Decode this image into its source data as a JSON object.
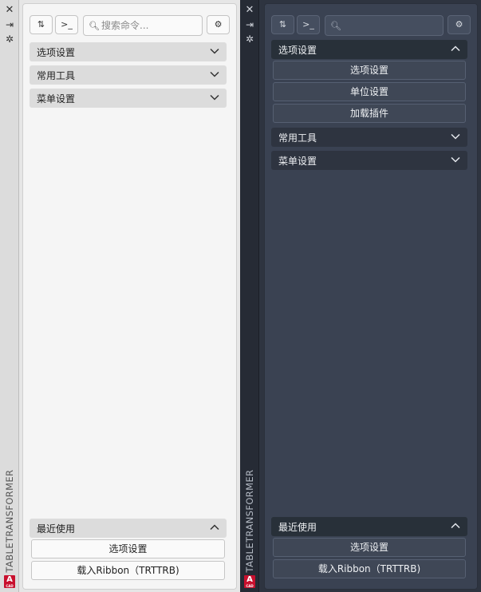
{
  "palette_title": "TABLETRANSFORMER",
  "search": {
    "placeholder": "搜索命令..."
  },
  "icons": {
    "close": "close-icon",
    "pin": "pin-icon",
    "settings": "settings-icon",
    "sort": "sort-icon",
    "prompt": "command-prompt-icon",
    "search": "search-icon",
    "chevron_down": "chevron-down-icon",
    "chevron_up": "chevron-up-icon",
    "logo": "autocad-logo"
  },
  "colors": {
    "light_bg": "#f5f5f5",
    "light_section": "#dcdcdc",
    "dark_bg": "#3a4252",
    "dark_section": "#2e3440",
    "logo_red": "#c8102e"
  },
  "light": {
    "sections": [
      {
        "label": "选项设置",
        "expanded": false
      },
      {
        "label": "常用工具",
        "expanded": false
      },
      {
        "label": "菜单设置",
        "expanded": false
      }
    ],
    "recent": {
      "label": "最近使用",
      "expanded": true,
      "items": [
        "选项设置",
        "载入Ribbon（TRTTRB)"
      ]
    }
  },
  "dark": {
    "sections": [
      {
        "label": "选项设置",
        "expanded": true,
        "items": [
          "选项设置",
          "单位设置",
          "加载插件"
        ]
      },
      {
        "label": "常用工具",
        "expanded": false
      },
      {
        "label": "菜单设置",
        "expanded": false
      }
    ],
    "recent": {
      "label": "最近使用",
      "expanded": true,
      "items": [
        "选项设置",
        "载入Ribbon（TRTTRB)"
      ]
    }
  }
}
